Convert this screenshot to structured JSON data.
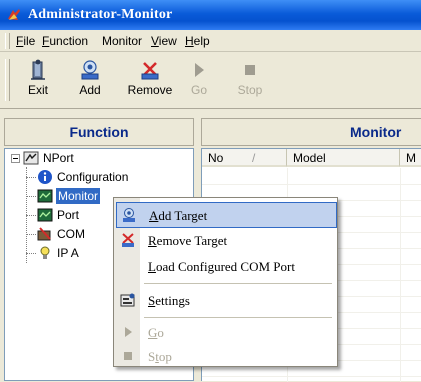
{
  "window": {
    "title": "Administrator-Monitor"
  },
  "menu": [
    {
      "pre": "",
      "mn": "F",
      "post": "ile"
    },
    {
      "pre": "",
      "mn": "F",
      "post": "unction"
    },
    {
      "pre": "Monitor",
      "mn": "",
      "post": ""
    },
    {
      "pre": "",
      "mn": "V",
      "post": "iew"
    },
    {
      "pre": "",
      "mn": "H",
      "post": "elp"
    }
  ],
  "toolbar": {
    "exit": "Exit",
    "add": "Add",
    "remove": "Remove",
    "go": "Go",
    "stop": "Stop"
  },
  "function_panel": {
    "title": "Function"
  },
  "monitor_panel": {
    "title": "Monitor"
  },
  "tree": {
    "root": "NPort",
    "children": [
      "Configuration",
      "Monitor",
      "Port",
      "COM",
      "IP A"
    ]
  },
  "grid": {
    "columns": [
      "No",
      "Model",
      "M"
    ],
    "sort_indicator": "/"
  },
  "context_menu": {
    "items": [
      {
        "pre": "",
        "mn": "A",
        "post": "dd Target"
      },
      {
        "pre": "",
        "mn": "R",
        "post": "emove Target"
      },
      {
        "pre": "",
        "mn": "L",
        "post": "oad Configured COM Port"
      },
      {
        "pre": "",
        "mn": "S",
        "post": "ettings"
      },
      {
        "pre": "",
        "mn": "G",
        "post": "o"
      },
      {
        "pre": "S",
        "mn": "t",
        "post": "op"
      }
    ]
  },
  "colors": {
    "title_bar": "#0a5bd9",
    "highlight": "#c1d2ee",
    "panel_title": "#0a2a8a"
  }
}
